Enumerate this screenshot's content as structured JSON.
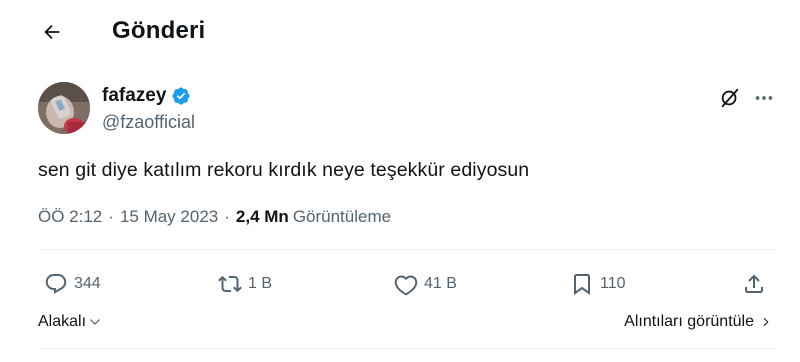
{
  "header": {
    "title": "Gönderi",
    "back_icon": "arrow-left-icon"
  },
  "author": {
    "display_name": "fafazey",
    "handle": "@fzaofficial",
    "verified": true,
    "verified_color": "#1d9bf0"
  },
  "post": {
    "text": "sen git diye katılım rekoru kırdık neye teşekkür ediyosun",
    "time": "ÖÖ 2:12",
    "date": "15 May 2023",
    "views_count": "2,4 Mn",
    "views_label": "Görüntüleme",
    "separator": "·"
  },
  "actions": {
    "replies": "344",
    "reposts": "1 B",
    "likes": "41 B",
    "bookmarks": "110"
  },
  "footer": {
    "sort_label": "Alakalı",
    "quotes_label": "Alıntıları görüntüle"
  },
  "colors": {
    "text": "#0f1419",
    "muted": "#536471",
    "divider": "#eff3f4",
    "accent": "#1d9bf0"
  }
}
